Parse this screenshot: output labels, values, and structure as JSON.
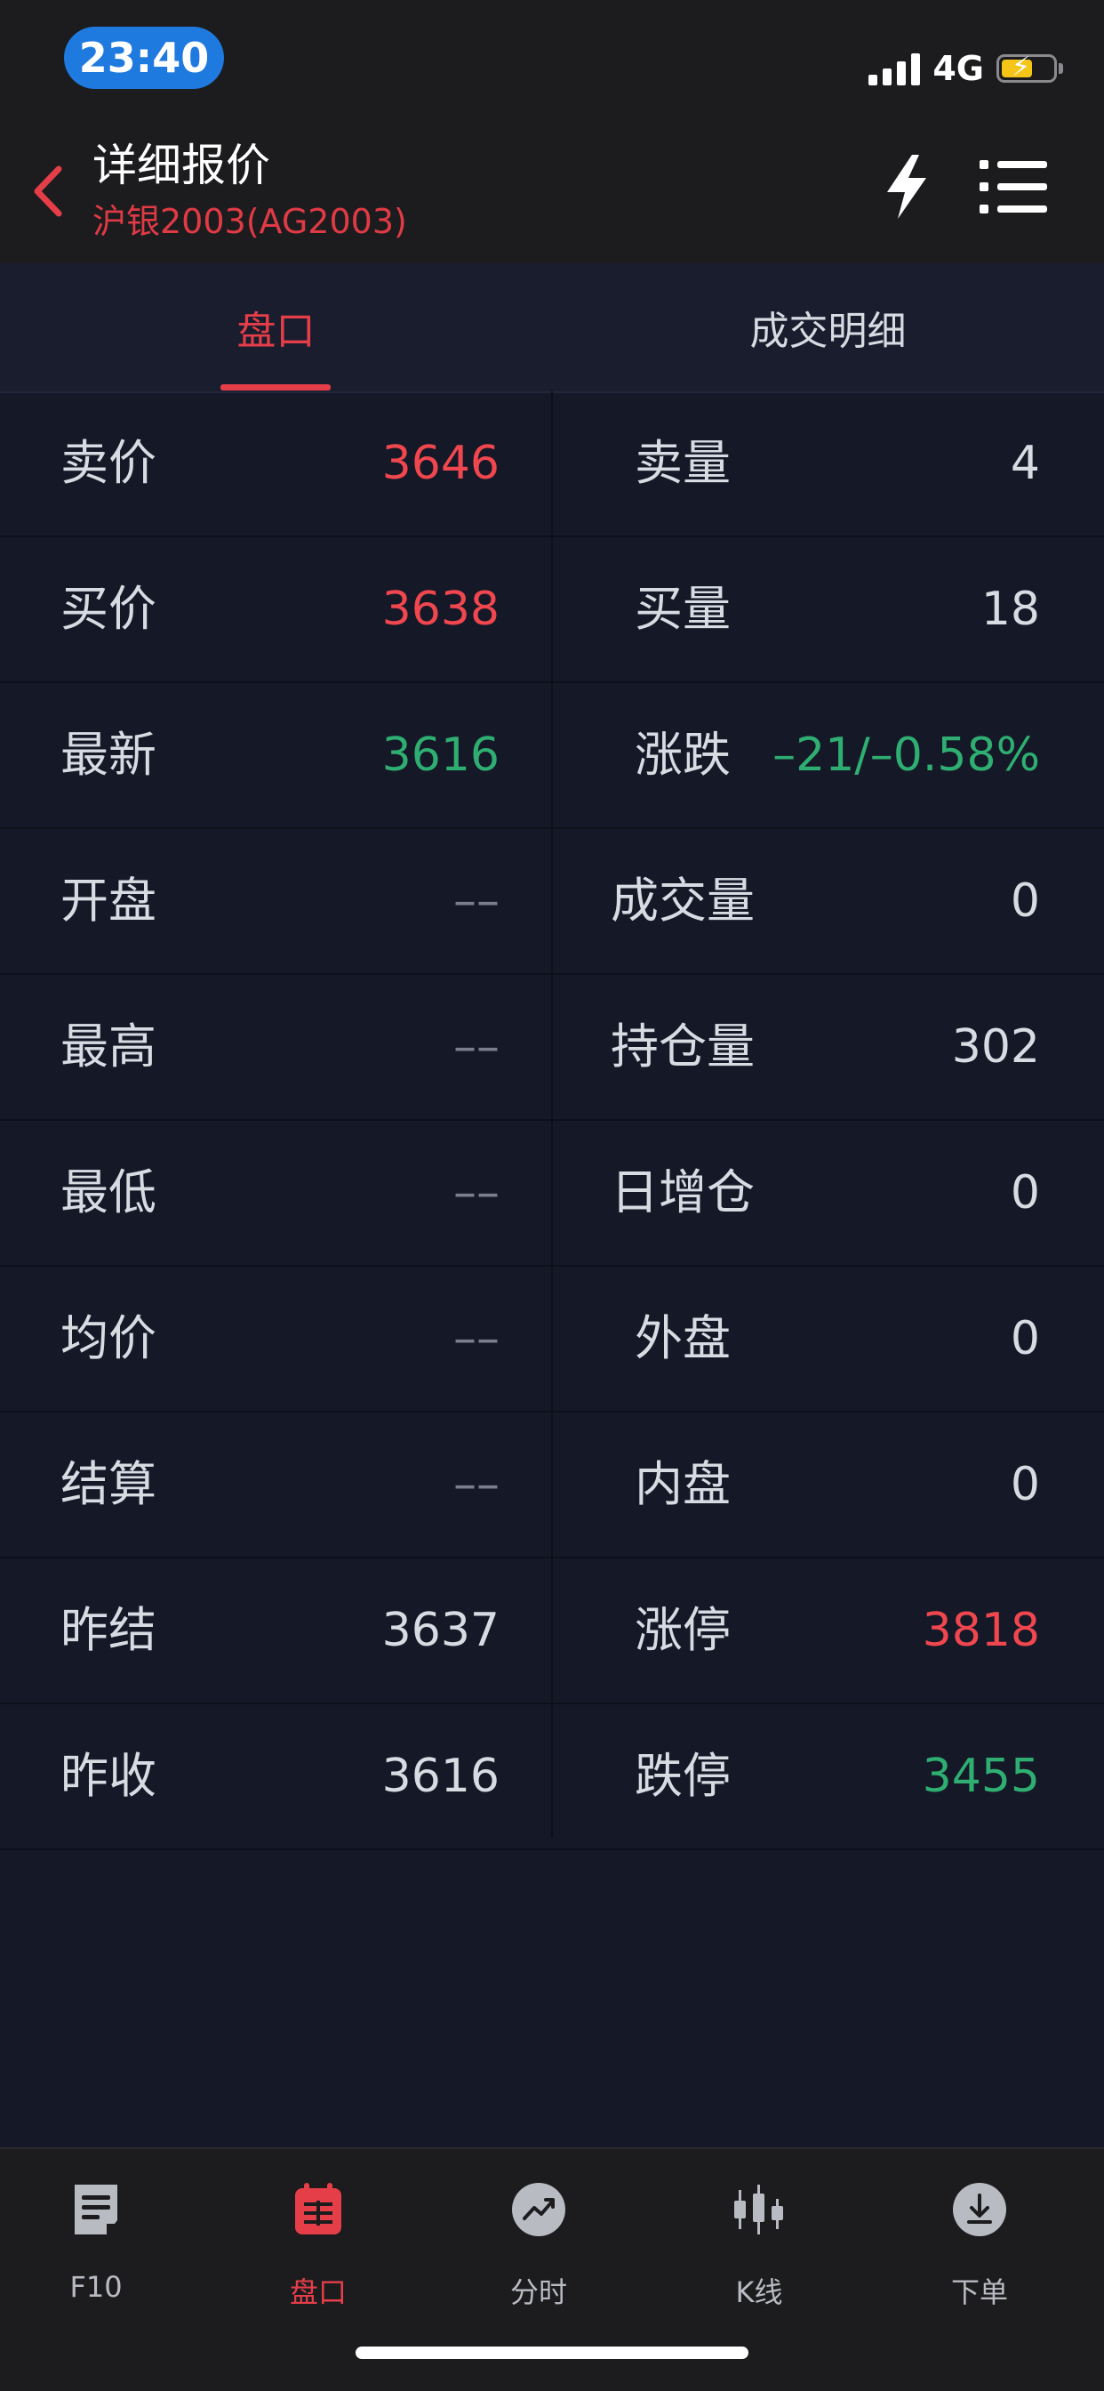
{
  "status_bar": {
    "time": "23:40",
    "network": "4G"
  },
  "header": {
    "title": "详细报价",
    "subtitle": "沪银2003(AG2003)"
  },
  "tabs": [
    {
      "label": "盘口",
      "active": true
    },
    {
      "label": "成交明细",
      "active": false
    }
  ],
  "rows": [
    {
      "left_label": "卖价",
      "left_value": "3646",
      "left_color": "red",
      "right_label": "卖量",
      "right_value": "4",
      "right_color": "white"
    },
    {
      "left_label": "买价",
      "left_value": "3638",
      "left_color": "red",
      "right_label": "买量",
      "right_value": "18",
      "right_color": "white"
    },
    {
      "left_label": "最新",
      "left_value": "3616",
      "left_color": "green",
      "right_label": "涨跌",
      "right_value": "–21/–0.58%",
      "right_color": "green"
    },
    {
      "left_label": "开盘",
      "left_value": "––",
      "left_color": "gray",
      "right_label": "成交量",
      "right_value": "0",
      "right_color": "white"
    },
    {
      "left_label": "最高",
      "left_value": "––",
      "left_color": "gray",
      "right_label": "持仓量",
      "right_value": "302",
      "right_color": "white"
    },
    {
      "left_label": "最低",
      "left_value": "––",
      "left_color": "gray",
      "right_label": "日增仓",
      "right_value": "0",
      "right_color": "white"
    },
    {
      "left_label": "均价",
      "left_value": "––",
      "left_color": "gray",
      "right_label": "外盘",
      "right_value": "0",
      "right_color": "white"
    },
    {
      "left_label": "结算",
      "left_value": "––",
      "left_color": "gray",
      "right_label": "内盘",
      "right_value": "0",
      "right_color": "white"
    },
    {
      "left_label": "昨结",
      "left_value": "3637",
      "left_color": "white",
      "right_label": "涨停",
      "right_value": "3818",
      "right_color": "red"
    },
    {
      "left_label": "昨收",
      "left_value": "3616",
      "left_color": "white",
      "right_label": "跌停",
      "right_value": "3455",
      "right_color": "green"
    }
  ],
  "bottom_tabs": [
    {
      "label": "F10",
      "icon": "document-icon",
      "active": false
    },
    {
      "label": "盘口",
      "icon": "orderbook-icon",
      "active": true
    },
    {
      "label": "分时",
      "icon": "trend-icon",
      "active": false
    },
    {
      "label": "K线",
      "icon": "candlestick-icon",
      "active": false
    },
    {
      "label": "下单",
      "icon": "download-icon",
      "active": false
    }
  ],
  "colors": {
    "accent": "#e53e49",
    "up": "#f0474f",
    "down": "#2fae72",
    "background": "#151827"
  }
}
